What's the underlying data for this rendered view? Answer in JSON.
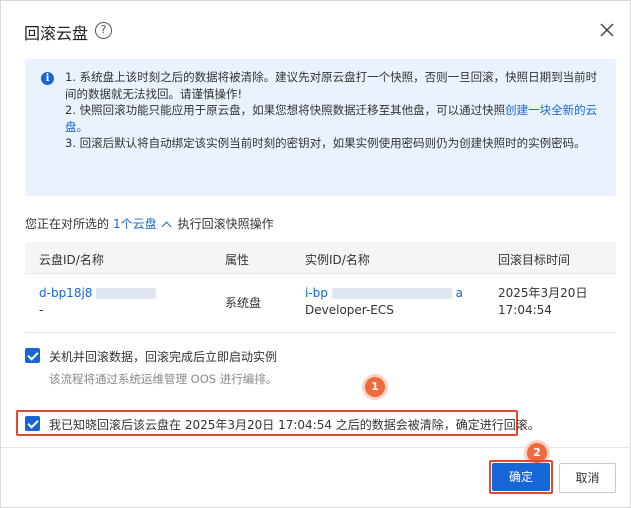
{
  "dialog": {
    "title": "回滚云盘",
    "help_glyph": "?"
  },
  "notice": {
    "line1": "1. 系统盘上该时刻之后的数据将被清除。建议先对原云盘打一个快照，否则一旦回滚，快照日期到当前时间的数据就无法找回。请谨慎操作!",
    "line2_prefix": "2. 快照回滚功能只能应用于原云盘，如果您想将快照数据迁移至其他盘，可以通过快照",
    "line2_link": "创建一块全新的云盘。",
    "line3": "3. 回滚后默认将自动绑定该实例当前时刻的密钥对，如果实例使用密码则仍为创建快照时的实例密码。"
  },
  "selection": {
    "prefix": "您正在对所选的",
    "count_link": "1个云盘",
    "suffix": "执行回滚快照操作"
  },
  "table": {
    "headers": [
      "云盘ID/名称",
      "属性",
      "实例ID/名称",
      "回滚目标时间"
    ],
    "row": {
      "disk_id": "d-bp18j8",
      "disk_name": "-",
      "attribute": "系统盘",
      "instance_id_prefix": "i-bp",
      "instance_id_suffix": "a",
      "instance_name": "Developer-ECS",
      "target_date": "2025年3月20日",
      "target_time": "17:04:54"
    }
  },
  "options": {
    "shutdown_label": "关机并回滚数据，回滚完成后立即启动实例",
    "shutdown_note": "该流程将通过系统运维管理 OOS 进行编排。",
    "ack_label": "我已知晓回滚后该云盘在 2025年3月20日 17:04:54 之后的数据会被清除，确定进行回滚。"
  },
  "steps": {
    "one": "1",
    "two": "2"
  },
  "footer": {
    "confirm_label": "确定",
    "cancel_label": "取消"
  },
  "colors": {
    "primary": "#1766d8",
    "highlight": "#e2492f",
    "badge": "#ef6a3c",
    "notice_bg": "#e9f2fe"
  }
}
